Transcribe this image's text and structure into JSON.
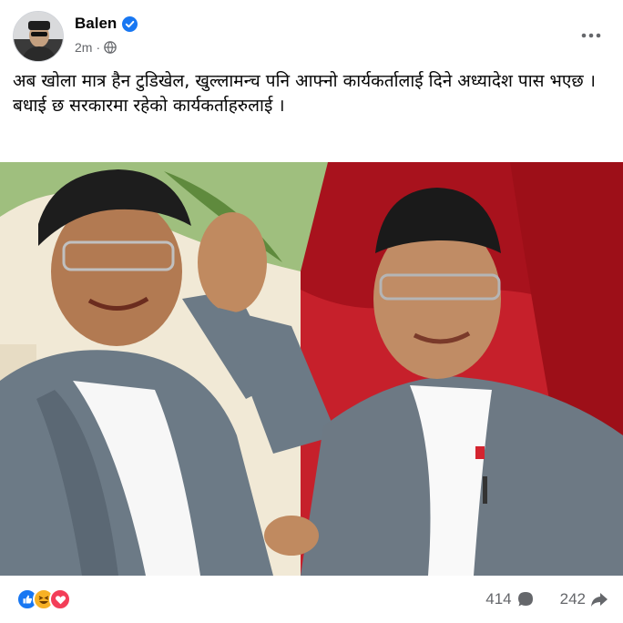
{
  "post": {
    "author": "Balen",
    "timestamp": "2m",
    "separator": "·",
    "privacy_icon": "globe-icon",
    "verified_icon": "verified-badge-icon",
    "more_icon": "more-options-icon",
    "caption_line1": "अब खोला मात्र हैन टुडिखेल, खुल्लामन्च पनि आफ्नो कार्यकर्तालाई दिने अध्यादेश पास भएछ ।",
    "caption_line2": "बधाई छ सरकारमा रहेको कार्यकर्ताहरुलाई ।"
  },
  "photo": {
    "description_icon": "post-photo"
  },
  "footer": {
    "reactions": [
      "like-icon",
      "haha-icon",
      "love-icon"
    ],
    "comments_count": "414",
    "comments_icon": "comment-icon",
    "shares_count": "242",
    "shares_icon": "share-icon"
  },
  "colors": {
    "accent": "#1877f2",
    "text_secondary": "#65676b",
    "love": "#f33e58",
    "haha": "#f7b125"
  }
}
